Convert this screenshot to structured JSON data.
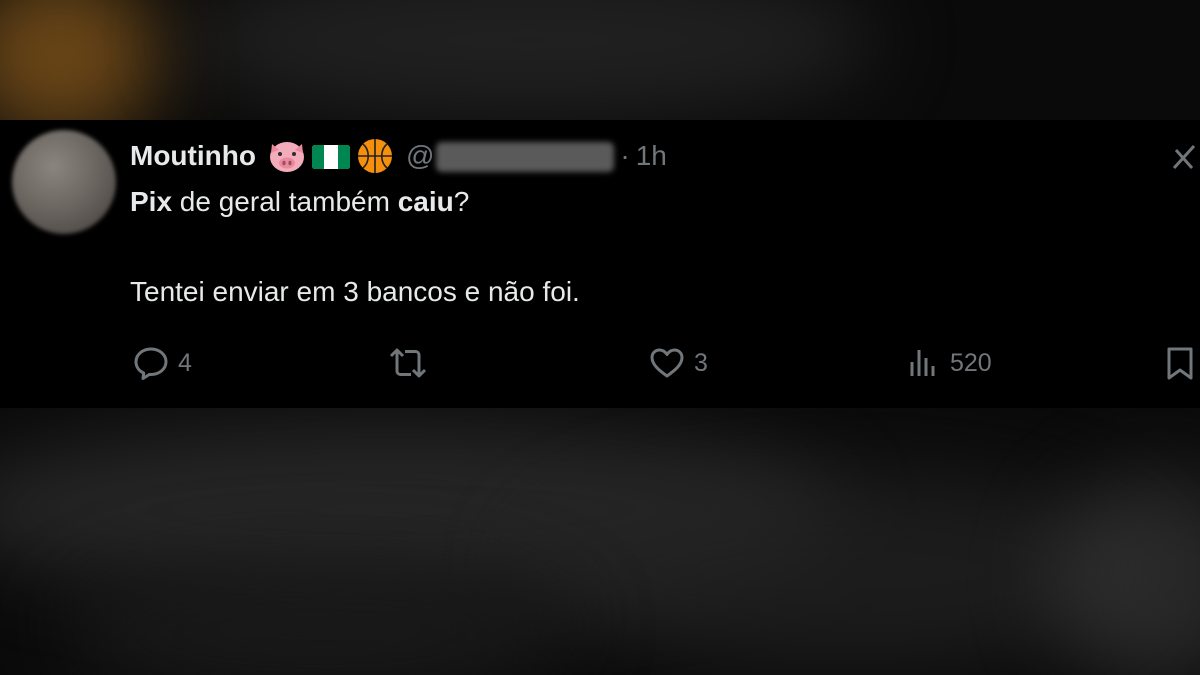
{
  "tweet": {
    "author_name": "Moutinho",
    "emojis": [
      "pig-face-emoji",
      "flag-nigeria-emoji",
      "basketball-emoji"
    ],
    "handle_prefix": "@",
    "separator": "·",
    "time": "1h",
    "text": {
      "line1_bold1": "Pix",
      "line1_mid": " de geral também ",
      "line1_bold2": "caiu",
      "line1_end": "?",
      "line2": "Tentei enviar em 3 bancos e não foi."
    },
    "actions": {
      "replies": "4",
      "retweets": "",
      "likes": "3",
      "views": "520"
    }
  },
  "icons": {
    "reply": "reply-icon",
    "retweet": "retweet-icon",
    "like": "heart-icon",
    "views": "views-icon",
    "bookmark": "bookmark-icon",
    "more": "more-icon"
  },
  "colors": {
    "card_background": "#000000",
    "text": "#e7e9ea",
    "secondary_text": "#71767b"
  }
}
